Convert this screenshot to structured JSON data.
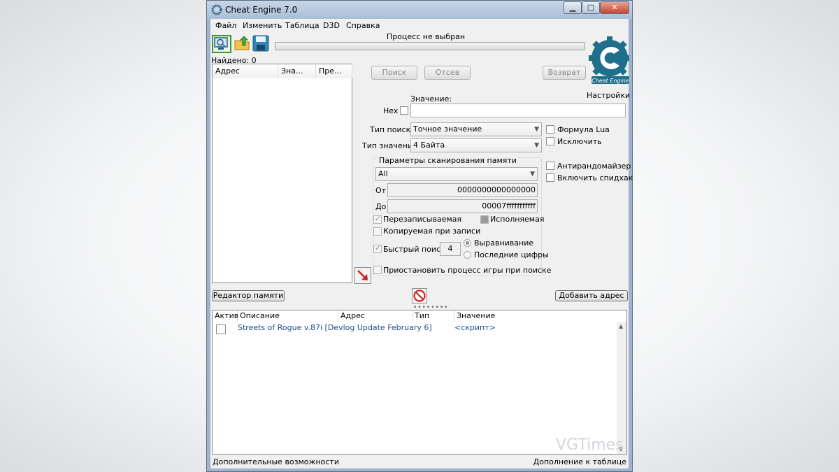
{
  "window": {
    "title": "Cheat Engine 7.0",
    "controls": {
      "minimize": "▁",
      "maximize": "□",
      "close": "✕"
    }
  },
  "menu": [
    "Файл",
    "Изменить",
    "Таблица",
    "D3D",
    "Справка"
  ],
  "toolbar": {
    "icons": [
      "open-process-icon",
      "open-file-icon",
      "save-icon"
    ]
  },
  "process": {
    "label": "Процесс не выбран"
  },
  "found": {
    "label": "Найдено: 0"
  },
  "results_list": {
    "columns": [
      "Адрес",
      "Зна...",
      "Пре..."
    ]
  },
  "scan_buttons": {
    "first_scan": "Поиск",
    "next_scan": "Отсев",
    "undo": "Возврат"
  },
  "logo": {
    "text": "Cheat Engine",
    "brand_color": "#1f6f8b"
  },
  "settings": {
    "label": "Настройки"
  },
  "value": {
    "label": "Значение:",
    "hex_label": "Hex",
    "value": ""
  },
  "scan_type": {
    "label": "Тип поиска",
    "selected": "Точное значение"
  },
  "value_type": {
    "label": "Тип значения",
    "selected": "4 Байта"
  },
  "right_options": {
    "lua_formula": "Формула Lua",
    "exclude": "Исключить",
    "antirandomizer": "Антирандомайзер",
    "speedhack": "Включить спидхак"
  },
  "memory_scan": {
    "title": "Параметры сканирования памяти",
    "region": "All",
    "from_label": "От",
    "from_value": "0000000000000000",
    "to_label": "До",
    "to_value": "00007fffffffffff",
    "writable": "Перезаписываемая",
    "executable": "Исполняемая",
    "copy_on_write": "Копируемая при записи",
    "fast_scan": "Быстрый поиск",
    "fast_scan_value": "4",
    "alignment": "Выравнивание",
    "last_digits": "Последние цифры",
    "pause": "Приостановить процесс игры при поиске"
  },
  "memory_view_button": "Редактор памяти",
  "add_address_button": "Добавить адрес",
  "address_table": {
    "columns": [
      "Актив.",
      "Описание",
      "Адрес",
      "Тип",
      "Значение"
    ],
    "rows": [
      {
        "active": false,
        "description": "Streets of Rogue v.87i [Devlog Update February 6]",
        "address": "",
        "type": "",
        "value": "<скрипт>"
      }
    ],
    "text_color": "#1a4f8f"
  },
  "bottom": {
    "advanced": "Дополнительные возможности",
    "table_extras": "Дополнение к таблице"
  },
  "watermark": "VGTimes"
}
